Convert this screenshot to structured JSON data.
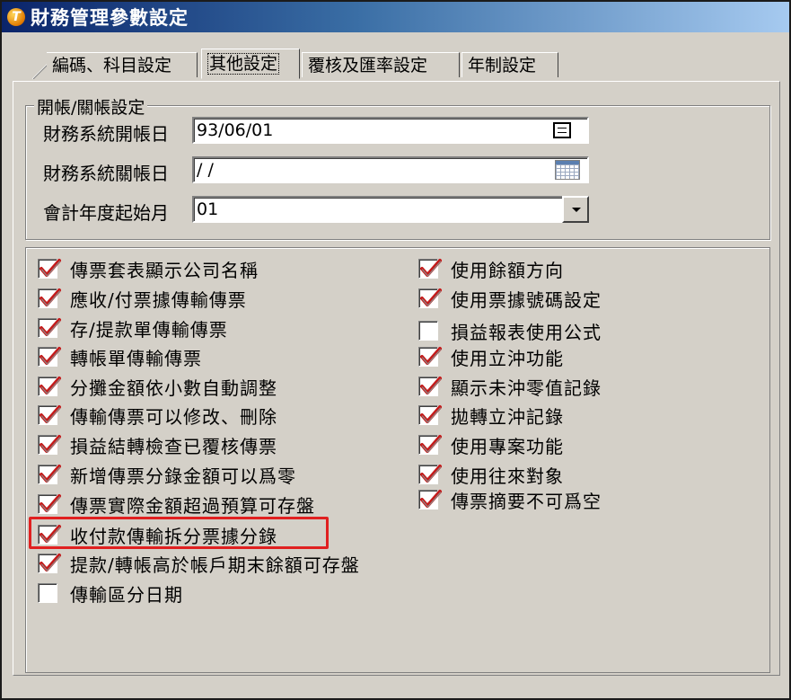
{
  "window": {
    "title": "財務管理參數設定",
    "icon": "app-logo-icon"
  },
  "tabs": [
    {
      "label": "編碼、科目設定"
    },
    {
      "label": "其他設定",
      "active": true
    },
    {
      "label": "覆核及匯率設定"
    },
    {
      "label": "年制設定"
    }
  ],
  "account_period": {
    "group_title": "開帳/關帳設定",
    "open_date": {
      "label": "財務系統開帳日",
      "value": "93/06/01"
    },
    "close_date": {
      "label": "財務系統關帳日",
      "value": " / /"
    },
    "fiscal_start_month": {
      "label": "會計年度起始月",
      "value": "01"
    }
  },
  "options": {
    "left": [
      {
        "label": "傳票套表顯示公司名稱",
        "checked": true
      },
      {
        "label": "應收/付票據傳輸傳票",
        "checked": true
      },
      {
        "label": "存/提款單傳輸傳票",
        "checked": true
      },
      {
        "label": "轉帳單傳輸傳票",
        "checked": true
      },
      {
        "label": "分攤金額依小數自動調整",
        "checked": true
      },
      {
        "label": "傳輸傳票可以修改、刪除",
        "checked": true
      },
      {
        "label": "損益結轉檢查已覆核傳票",
        "checked": true
      },
      {
        "label": "新增傳票分錄金額可以爲零",
        "checked": true
      },
      {
        "label": "傳票實際金額超過預算可存盤",
        "checked": true
      },
      {
        "label": "收付款傳輸拆分票據分錄",
        "checked": true,
        "highlighted": true
      },
      {
        "label": "提款/轉帳高於帳戶期末餘額可存盤",
        "checked": true
      },
      {
        "label": "傳輸區分日期",
        "checked": false
      }
    ],
    "right": [
      {
        "label": "使用餘額方向",
        "checked": true
      },
      {
        "label": "使用票據號碼設定",
        "checked": true
      },
      {
        "label": "損益報表使用公式",
        "checked": false
      },
      {
        "label": "使用立沖功能",
        "checked": true
      },
      {
        "label": "顯示未沖零值記錄",
        "checked": true
      },
      {
        "label": "拋轉立沖記錄",
        "checked": true
      },
      {
        "label": "使用專案功能",
        "checked": true
      },
      {
        "label": "使用往來對象",
        "checked": true
      },
      {
        "label": "傳票摘要不可爲空",
        "checked": true
      }
    ]
  },
  "colors": {
    "check_mark": "#c41a1a",
    "highlight_border": "#e02020",
    "title_bar": "#0a246a"
  }
}
